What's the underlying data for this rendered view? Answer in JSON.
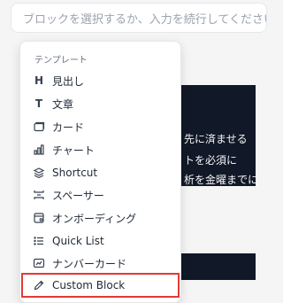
{
  "editor": {
    "placeholder": "ブロックを選択するか、入力を続行してください"
  },
  "background_card": {
    "lines": [
      "先に済ませる",
      "トを必須に",
      "析を金曜までに"
    ]
  },
  "dropdown": {
    "header": "テンプレート",
    "items": [
      {
        "label": "見出し",
        "icon": "heading-icon"
      },
      {
        "label": "文章",
        "icon": "text-icon"
      },
      {
        "label": "カード",
        "icon": "card-icon"
      },
      {
        "label": "チャート",
        "icon": "bar-chart-icon"
      },
      {
        "label": "Shortcut",
        "icon": "shortcut-icon"
      },
      {
        "label": "スペーサー",
        "icon": "spacer-icon"
      },
      {
        "label": "オンボーディング",
        "icon": "onboarding-icon"
      },
      {
        "label": "Quick List",
        "icon": "list-icon"
      },
      {
        "label": "ナンバーカード",
        "icon": "number-card-icon"
      },
      {
        "label": "Custom Block",
        "icon": "pencil-icon",
        "highlighted": true
      }
    ]
  },
  "colors": {
    "highlight": "#e53935",
    "dark_card": "#111827"
  }
}
